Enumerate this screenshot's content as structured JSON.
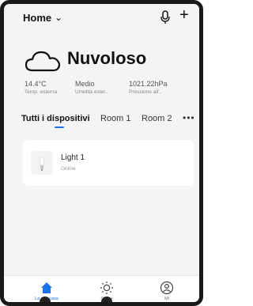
{
  "header": {
    "home_label": "Home",
    "chevron": "⌄",
    "plus": "+"
  },
  "weather": {
    "condition": "Nuvoloso"
  },
  "metrics": [
    {
      "value": "14.4°C",
      "label": "Temp. esterna"
    },
    {
      "value": "Medio",
      "label": "Umidità ester.."
    },
    {
      "value": "1021.22hPa",
      "label": "Pressione all'.."
    }
  ],
  "tabs": {
    "all": "Tutti i dispositivi",
    "room1": "Room 1",
    "room2": "Room 2",
    "more": "•••"
  },
  "device": {
    "name": "Light 1",
    "status": "Online"
  },
  "bottom_nav": {
    "home": "La mia casa",
    "scenes": "Scene",
    "me": "Mi"
  },
  "colors": {
    "accent": "#1a73e8",
    "frame": "#1a1a1a",
    "background": "#f3f4f6"
  }
}
